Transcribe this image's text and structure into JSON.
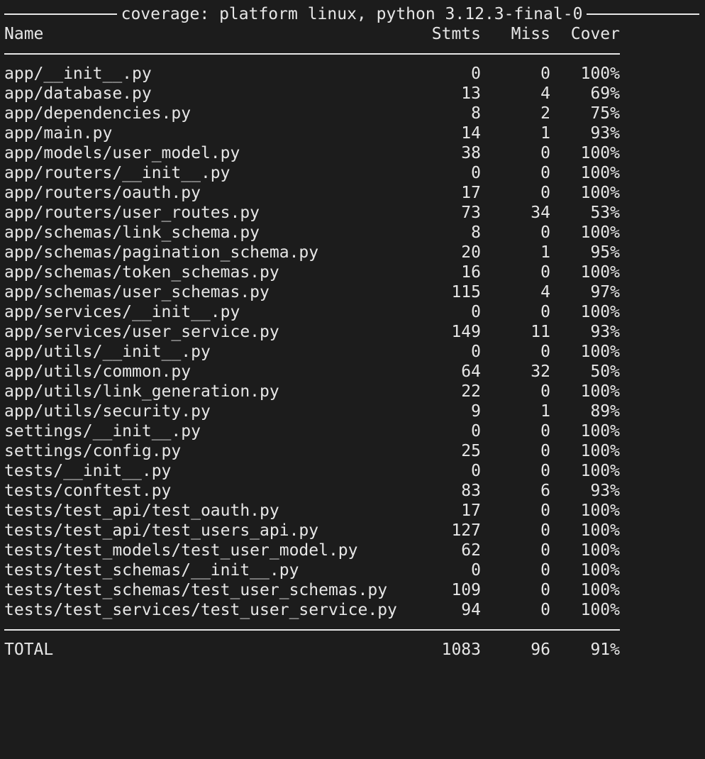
{
  "banner": "coverage: platform linux, python 3.12.3-final-0",
  "headers": {
    "name": "Name",
    "stmts": "Stmts",
    "miss": "Miss",
    "cover": "Cover"
  },
  "rows": [
    {
      "name": "app/__init__.py",
      "stmts": "0",
      "miss": "0",
      "cover": "100%"
    },
    {
      "name": "app/database.py",
      "stmts": "13",
      "miss": "4",
      "cover": "69%"
    },
    {
      "name": "app/dependencies.py",
      "stmts": "8",
      "miss": "2",
      "cover": "75%"
    },
    {
      "name": "app/main.py",
      "stmts": "14",
      "miss": "1",
      "cover": "93%"
    },
    {
      "name": "app/models/user_model.py",
      "stmts": "38",
      "miss": "0",
      "cover": "100%"
    },
    {
      "name": "app/routers/__init__.py",
      "stmts": "0",
      "miss": "0",
      "cover": "100%"
    },
    {
      "name": "app/routers/oauth.py",
      "stmts": "17",
      "miss": "0",
      "cover": "100%"
    },
    {
      "name": "app/routers/user_routes.py",
      "stmts": "73",
      "miss": "34",
      "cover": "53%"
    },
    {
      "name": "app/schemas/link_schema.py",
      "stmts": "8",
      "miss": "0",
      "cover": "100%"
    },
    {
      "name": "app/schemas/pagination_schema.py",
      "stmts": "20",
      "miss": "1",
      "cover": "95%"
    },
    {
      "name": "app/schemas/token_schemas.py",
      "stmts": "16",
      "miss": "0",
      "cover": "100%"
    },
    {
      "name": "app/schemas/user_schemas.py",
      "stmts": "115",
      "miss": "4",
      "cover": "97%"
    },
    {
      "name": "app/services/__init__.py",
      "stmts": "0",
      "miss": "0",
      "cover": "100%"
    },
    {
      "name": "app/services/user_service.py",
      "stmts": "149",
      "miss": "11",
      "cover": "93%"
    },
    {
      "name": "app/utils/__init__.py",
      "stmts": "0",
      "miss": "0",
      "cover": "100%"
    },
    {
      "name": "app/utils/common.py",
      "stmts": "64",
      "miss": "32",
      "cover": "50%"
    },
    {
      "name": "app/utils/link_generation.py",
      "stmts": "22",
      "miss": "0",
      "cover": "100%"
    },
    {
      "name": "app/utils/security.py",
      "stmts": "9",
      "miss": "1",
      "cover": "89%"
    },
    {
      "name": "settings/__init__.py",
      "stmts": "0",
      "miss": "0",
      "cover": "100%"
    },
    {
      "name": "settings/config.py",
      "stmts": "25",
      "miss": "0",
      "cover": "100%"
    },
    {
      "name": "tests/__init__.py",
      "stmts": "0",
      "miss": "0",
      "cover": "100%"
    },
    {
      "name": "tests/conftest.py",
      "stmts": "83",
      "miss": "6",
      "cover": "93%"
    },
    {
      "name": "tests/test_api/test_oauth.py",
      "stmts": "17",
      "miss": "0",
      "cover": "100%"
    },
    {
      "name": "tests/test_api/test_users_api.py",
      "stmts": "127",
      "miss": "0",
      "cover": "100%"
    },
    {
      "name": "tests/test_models/test_user_model.py",
      "stmts": "62",
      "miss": "0",
      "cover": "100%"
    },
    {
      "name": "tests/test_schemas/__init__.py",
      "stmts": "0",
      "miss": "0",
      "cover": "100%"
    },
    {
      "name": "tests/test_schemas/test_user_schemas.py",
      "stmts": "109",
      "miss": "0",
      "cover": "100%"
    },
    {
      "name": "tests/test_services/test_user_service.py",
      "stmts": "94",
      "miss": "0",
      "cover": "100%"
    }
  ],
  "total": {
    "name": "TOTAL",
    "stmts": "1083",
    "miss": "96",
    "cover": "91%"
  }
}
